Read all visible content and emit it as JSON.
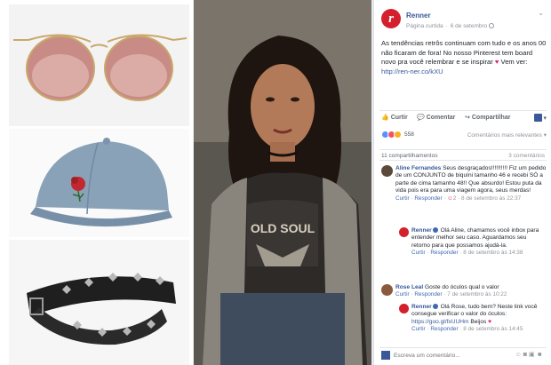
{
  "page": {
    "name": "Renner",
    "logo_letter": "r",
    "subtitle": "Página curtida",
    "date": "6 de setembro",
    "menu_icon": "chevron-down-icon"
  },
  "post": {
    "text": "As tendências retrôs continuam com tudo e os anos 00 não ficaram de fora! No nosso Pinterest tem board novo pra você relembrar e se inspirar",
    "text_tail": "Vem ver:",
    "link": "http://ren-ner.co/kXU"
  },
  "actions": {
    "like": "Curtir",
    "comment": "Comentar",
    "share": "Compartilhar"
  },
  "reactions": {
    "count": "558",
    "sort": "Comentários mais relevantes"
  },
  "shares": {
    "count": "11 compartilhamentos",
    "comments": "3 comentários"
  },
  "comments": [
    {
      "name": "Aline Fernandes",
      "text": "Seus desgraçados!!!!!!!!!! Fiz um pedido de um CONJUNTO de biquíni tamanho 46 e recebi SÓ a parte de cima tamanho 48!! Que absurdo! Estou puta da vida pois era para uma viagem agora, seus merdas!",
      "like": "Curtir",
      "reply": "Responder",
      "react_count": "2",
      "time": "8 de setembro às 22:37",
      "avatar_color": "#5b4a3a"
    },
    {
      "name": "Renner",
      "text": "Olá Aline, chamamos você inbox para entender melhor seu caso. Aguardamos seu retorno para que possamos ajudá-la.",
      "like": "Curtir",
      "reply": "Responder",
      "time": "8 de setembro às 14:38",
      "avatar_color": "#d3202c"
    },
    {
      "name": "Rose Leal",
      "text": "Goste do óculos qual o valor",
      "like": "Curtir",
      "reply": "Responder",
      "time": "7 de setembro às 10:22",
      "avatar_color": "#8a5a3c"
    },
    {
      "name": "Renner",
      "text": "Olá Rose, tudo bem? Neste link você consegue verificar o valor do óculos:",
      "link": "https://goo.gl/fxUUHm",
      "tail": "Beijos",
      "like": "Curtir",
      "reply": "Responder",
      "time": "8 de setembro às 14:45",
      "avatar_color": "#d3202c"
    }
  ],
  "composer": {
    "placeholder": "Escreva um comentário..."
  },
  "colors": {
    "brand": "#d3202c",
    "link": "#365899",
    "like": "#5890ff",
    "love": "#f25268"
  }
}
